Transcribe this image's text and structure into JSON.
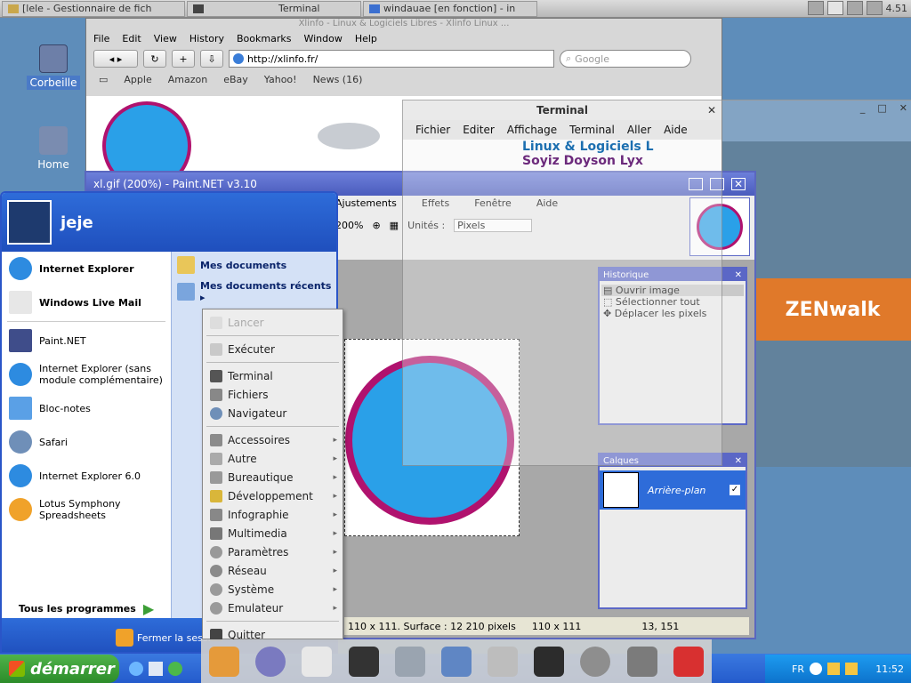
{
  "top_panel": {
    "tasks": [
      "[lele - Gestionnaire de fich",
      "Terminal",
      "windauae [en fonction] - in"
    ],
    "clock": "4.51"
  },
  "desktop": {
    "icons": [
      {
        "label": "Corbeille"
      },
      {
        "label": "Home"
      }
    ]
  },
  "browser": {
    "title": "Xlinfo - Linux & Logiciels Libres - Xlinfo Linux ...",
    "menu": [
      "File",
      "Edit",
      "View",
      "History",
      "Bookmarks",
      "Window",
      "Help"
    ],
    "back_forward": "◂ ▸",
    "url": "http://xlinfo.fr/",
    "search_placeholder": "Google",
    "bookmarks": [
      "Apple",
      "Amazon",
      "eBay",
      "Yahoo!",
      "News (16)"
    ]
  },
  "terminal": {
    "title": "Terminal",
    "menu": [
      "Fichier",
      "Editer",
      "Affichage",
      "Terminal",
      "Aller",
      "Aide"
    ],
    "page_header": "Linux & Logiciels L",
    "page_header2": "Soyiz Doyson Lyx"
  },
  "zenwalk": {
    "logo": "ZENwalk"
  },
  "paintnet": {
    "title": "xl.gif (200%) - Paint.NET v3.10",
    "menu": [
      "Ajustements",
      "Effets",
      "Fenêtre",
      "Aide"
    ],
    "zoom": "200%",
    "units_label": "Unités :",
    "units_value": "Pixels",
    "history_title": "Historique",
    "history": [
      "Ouvrir image",
      "Sélectionner tout",
      "Déplacer les pixels"
    ],
    "layers_title": "Calques",
    "layer_name": "Arrière-plan",
    "status_selection": "110 x 111. Surface : 12 210 pixels",
    "status_size": "110 x 111",
    "status_pos": "13, 151"
  },
  "start_menu": {
    "user": "jeje",
    "left_items": [
      {
        "label": "Internet Explorer",
        "bold": true
      },
      {
        "label": "Windows Live Mail",
        "bold": true
      },
      {
        "label": "Paint.NET"
      },
      {
        "label": "Internet Explorer (sans module complémentaire)"
      },
      {
        "label": "Bloc-notes"
      },
      {
        "label": "Safari"
      },
      {
        "label": "Internet Explorer 6.0"
      },
      {
        "label": "Lotus Symphony Spreadsheets"
      }
    ],
    "all_programs": "Tous les programmes",
    "right_items": [
      {
        "label": "Mes documents"
      },
      {
        "label": "Mes documents récents ▸"
      }
    ],
    "footer_logoff": "Fermer la session"
  },
  "popup_menu": {
    "items": [
      {
        "label": "Lancer",
        "disabled": true
      },
      {
        "label": "Exécuter"
      },
      {
        "sep": true
      },
      {
        "label": "Terminal"
      },
      {
        "label": "Fichiers"
      },
      {
        "label": "Navigateur"
      },
      {
        "sep": true
      },
      {
        "label": "Accessoires",
        "sub": true
      },
      {
        "label": "Autre",
        "sub": true
      },
      {
        "label": "Bureautique",
        "sub": true
      },
      {
        "label": "Développement",
        "sub": true
      },
      {
        "label": "Infographie",
        "sub": true
      },
      {
        "label": "Multimedia",
        "sub": true
      },
      {
        "label": "Paramètres",
        "sub": true
      },
      {
        "label": "Réseau",
        "sub": true
      },
      {
        "label": "Système",
        "sub": true
      },
      {
        "label": "Emulateur",
        "sub": true
      },
      {
        "sep": true
      },
      {
        "label": "Quitter"
      }
    ]
  },
  "taskbar": {
    "start_label": "démarrer",
    "lang": "FR",
    "clock": "11:52"
  },
  "colors": {
    "xp_blue": "#2e6cd9",
    "xp_green": "#3c9e36",
    "pnet_blue": "#5b67c6",
    "xlinfo_blue": "#2aa0e8",
    "xlinfo_magenta": "#b0126e"
  }
}
